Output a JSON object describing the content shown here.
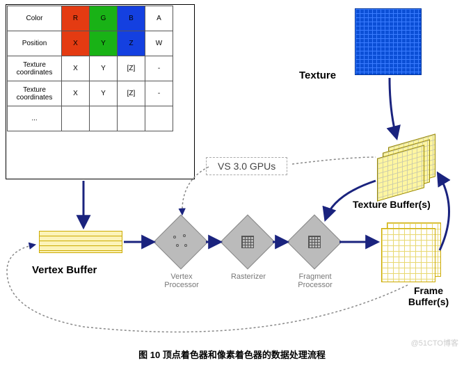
{
  "table": {
    "rows": [
      {
        "hdr": "Color",
        "c": [
          "R",
          "G",
          "B",
          "A"
        ],
        "bg": [
          "cR",
          "cG",
          "cB",
          ""
        ]
      },
      {
        "hdr": "Position",
        "c": [
          "X",
          "Y",
          "Z",
          "W"
        ],
        "bg": [
          "cR",
          "cG",
          "cB",
          ""
        ]
      },
      {
        "hdr": "Texture coordinates",
        "c": [
          "X",
          "Y",
          "[Z]",
          "-"
        ],
        "bg": [
          "",
          "",
          "",
          ""
        ]
      },
      {
        "hdr": "Texture coordinates",
        "c": [
          "X",
          "Y",
          "[Z]",
          "-"
        ],
        "bg": [
          "",
          "",
          "",
          ""
        ]
      },
      {
        "hdr": "...",
        "c": [
          "",
          "",
          "",
          ""
        ],
        "bg": [
          "",
          "",
          "",
          ""
        ]
      }
    ]
  },
  "labels": {
    "texture": "Texture",
    "vertex_buffer": "Vertex Buffer",
    "vertex_proc": "Vertex Processor",
    "rasterizer": "Rasterizer",
    "fragment_proc": "Fragment Processor",
    "texture_buffer": "Texture Buffer(s)",
    "frame_buffer": "Frame Buffer(s)",
    "vs_gpus": "VS 3.0 GPUs"
  },
  "caption": "图 10 顶点着色器和像素着色器的数据处理流程",
  "watermark": "@51CTO博客"
}
